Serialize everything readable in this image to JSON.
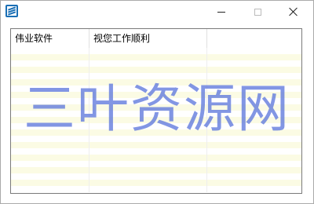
{
  "window": {
    "title": "",
    "icon": "app-logo-icon",
    "controls": {
      "minimize": "minimize-icon",
      "maximize": "maximize-icon",
      "close": "close-icon"
    }
  },
  "list": {
    "columns": [
      "伟业软件",
      "视您工作顺利",
      ""
    ],
    "row_stripe_color": "#fbfbe4"
  },
  "watermark": {
    "text": "三叶资源网",
    "color": "#5f78dc"
  }
}
